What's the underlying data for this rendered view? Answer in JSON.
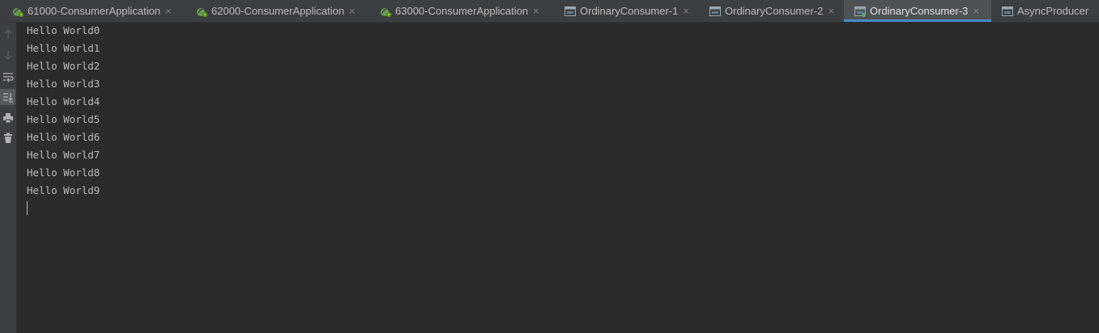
{
  "tabs": [
    {
      "label": "61000-ConsumerApplication",
      "icon": "spring-boot-icon",
      "active": false
    },
    {
      "label": "62000-ConsumerApplication",
      "icon": "spring-boot-icon",
      "active": false
    },
    {
      "label": "63000-ConsumerApplication",
      "icon": "spring-boot-icon",
      "active": false
    },
    {
      "label": "OrdinaryConsumer-1",
      "icon": "application-window-icon",
      "active": false
    },
    {
      "label": "OrdinaryConsumer-2",
      "icon": "application-window-icon",
      "active": false
    },
    {
      "label": "OrdinaryConsumer-3",
      "icon": "application-window-icon",
      "active": true
    },
    {
      "label": "AsyncProducer",
      "icon": "application-window-icon",
      "active": false
    }
  ],
  "close_glyph": "×",
  "toolbar": [
    {
      "name": "up-arrow-icon",
      "enabled": false
    },
    {
      "name": "down-arrow-icon",
      "enabled": false
    },
    {
      "name": "soft-wrap-icon",
      "enabled": true
    },
    {
      "name": "scroll-to-end-icon",
      "enabled": true,
      "selected": true
    },
    {
      "name": "print-icon",
      "enabled": true
    },
    {
      "name": "trash-icon",
      "enabled": true
    }
  ],
  "console": {
    "lines": [
      "Hello World0",
      "Hello World1",
      "Hello World2",
      "Hello World3",
      "Hello World4",
      "Hello World5",
      "Hello World6",
      "Hello World7",
      "Hello World8",
      "Hello World9"
    ]
  },
  "colors": {
    "background": "#2b2b2b",
    "tabbar": "#3c3f41",
    "active_tab": "#4e5254",
    "accent": "#4a88c7",
    "text": "#bbbbbb",
    "spring_green": "#6a9955"
  }
}
